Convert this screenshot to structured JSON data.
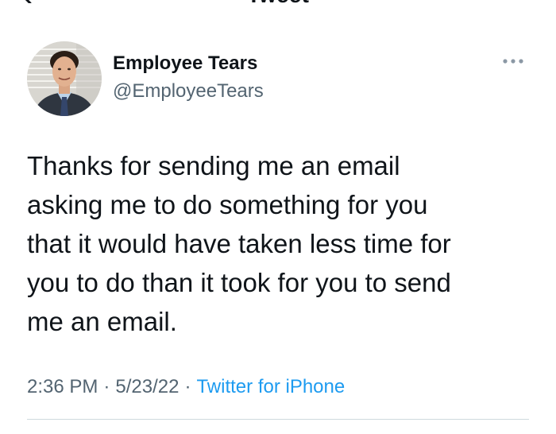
{
  "header": {
    "title": "Tweet"
  },
  "author": {
    "name": "Employee Tears",
    "handle": "@EmployeeTears"
  },
  "tweet": {
    "text": "Thanks for sending me an email\nasking me to do something for you\nthat it would have taken less time for\nyou to do than it took for you to send\nme an email."
  },
  "meta": {
    "time": "2:36 PM",
    "date": "5/23/22",
    "source": "Twitter for iPhone",
    "separator": "·"
  },
  "colors": {
    "text": "#0f1419",
    "secondary": "#536471",
    "link": "#1d9bf0",
    "divider": "#cfd9de"
  }
}
